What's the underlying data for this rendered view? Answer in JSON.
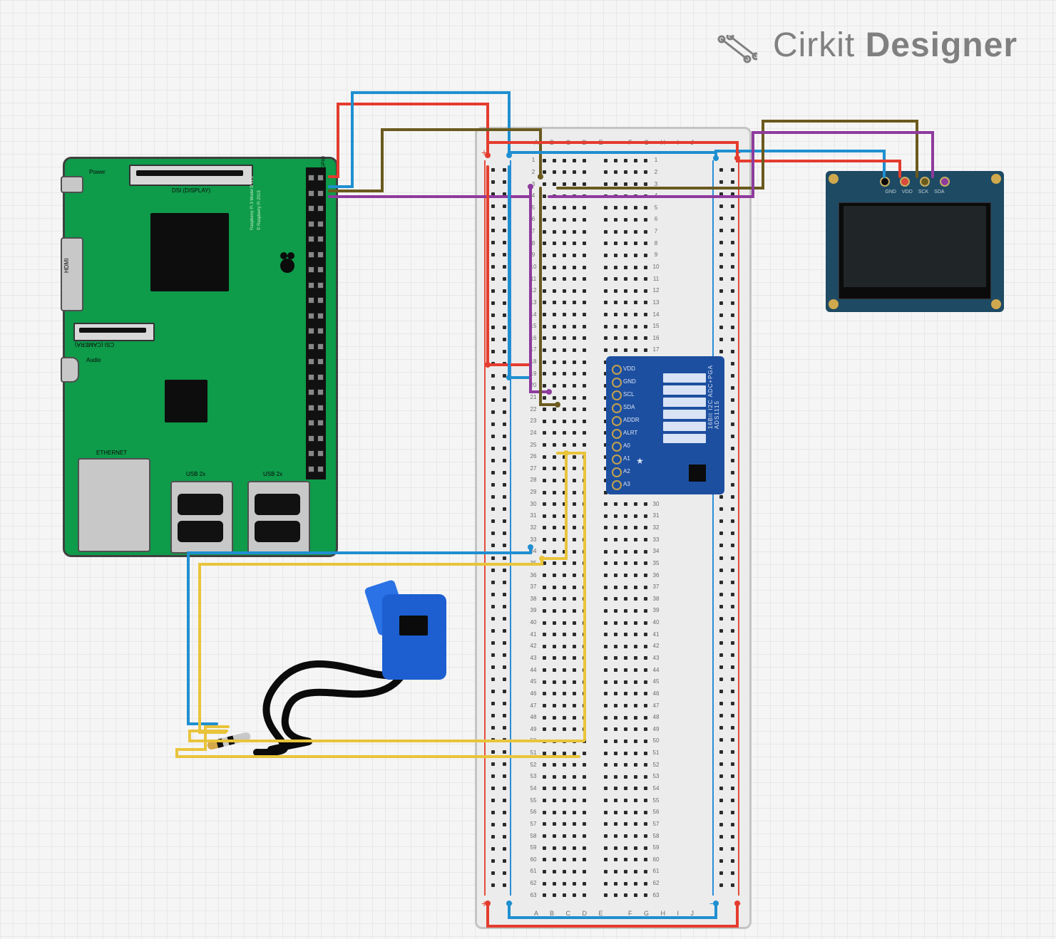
{
  "app": {
    "brand_prefix": "Cirkit",
    "brand_suffix": "Designer"
  },
  "rpi": {
    "labels": {
      "power": "Power",
      "dsi": "DSI (DISPLAY)",
      "hdmi": "HDMI",
      "csi": "CSI (CAMERA)",
      "audio": "Audio",
      "ethernet": "ETHERNET",
      "usb1": "USB 2x",
      "usb2": "USB 2x",
      "gpio": "GPIO",
      "model_line1": "Raspberry Pi 3 Model B v1.2",
      "model_line2": "© Raspberry Pi 2015"
    }
  },
  "breadboard": {
    "col_labels_left": "A  B  C  D  E",
    "col_labels_right": "F  G  H  I  J",
    "rail_plus": "+",
    "rail_minus": "−",
    "rows": 63
  },
  "ads1115": {
    "title": "16Bit I2C ADC+PGA",
    "model": "ADS1115",
    "pins": [
      "VDD",
      "GND",
      "SCL",
      "SDA",
      "ADDR",
      "ALRT",
      "A0",
      "A1",
      "A2",
      "A3"
    ]
  },
  "oled": {
    "pins": [
      "GND",
      "VDD",
      "SCK",
      "SDA"
    ]
  },
  "sensor": {
    "name": "SCT-013 current clamp"
  },
  "wires": [
    {
      "name": "rpi-3v3-to-bb-rail-red",
      "color": "#e43c2e"
    },
    {
      "name": "rpi-gnd-to-bb-rail-blue",
      "color": "#1f8fd1"
    },
    {
      "name": "rpi-sda-to-bb",
      "color": "#8e3b9e"
    },
    {
      "name": "rpi-scl-to-bb",
      "color": "#6a5a1e"
    },
    {
      "name": "bb-rail-red-to-ads-vdd",
      "color": "#e43c2e"
    },
    {
      "name": "bb-rail-blue-to-ads-gnd",
      "color": "#1f8fd1"
    },
    {
      "name": "bb-scl-to-ads",
      "color": "#8e3b9e"
    },
    {
      "name": "bb-sda-to-ads",
      "color": "#6a5a1e"
    },
    {
      "name": "bb-rail-to-oled-vdd",
      "color": "#e43c2e"
    },
    {
      "name": "bb-rail-to-oled-gnd",
      "color": "#1f8fd1"
    },
    {
      "name": "bb-scl-to-oled",
      "color": "#6a5a1e"
    },
    {
      "name": "bb-sda-to-oled",
      "color": "#8e3b9e"
    },
    {
      "name": "sensor-tip-to-bb",
      "color": "#1f8fd1"
    },
    {
      "name": "sensor-ring-to-bb",
      "color": "#e9c43b"
    },
    {
      "name": "ads-a0-to-bb",
      "color": "#e9c43b"
    },
    {
      "name": "bb-bottom-jumper-red",
      "color": "#e43c2e"
    },
    {
      "name": "bb-bottom-jumper-blue",
      "color": "#1f8fd1"
    }
  ]
}
